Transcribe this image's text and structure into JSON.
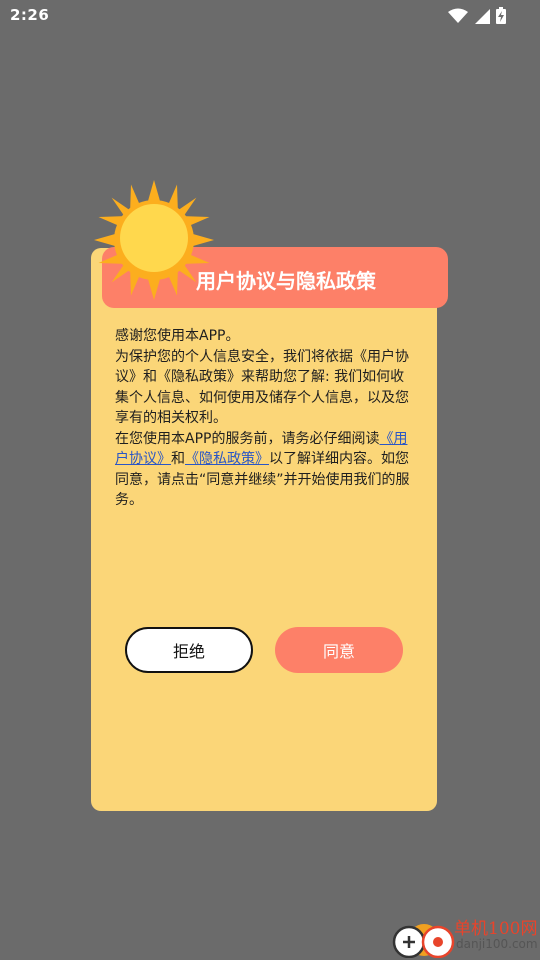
{
  "status_bar": {
    "time": "2:26",
    "icons": [
      "wifi-icon",
      "signal-icon",
      "battery-charging-icon"
    ]
  },
  "dialog": {
    "title": "用户协议与隐私政策",
    "paragraphs": {
      "p1": "感谢您使用本APP。",
      "p2": "为保护您的个人信息安全，我们将依据《用户协议》和《隐私政策》来帮助您了解: 我们如何收集个人信息、如何使用及储存个人信息，以及您享有的相关权利。",
      "p3_prefix": "在您使用本APP的服务前，请务必仔细阅读",
      "link_user_agreement": "《用户协议》",
      "and": "和",
      "link_privacy_policy": "《隐私政策》",
      "p3_suffix": "以了解详细内容。如您同意，请点击“同意并继续”并开始使用我们的服务。"
    },
    "buttons": {
      "reject": "拒绝",
      "agree": "同意"
    }
  },
  "colors": {
    "overlay": "#6b6b6b",
    "card": "#fbd678",
    "accent": "#fd8068",
    "link": "#2a56c6",
    "sun_core": "#ffd84d",
    "sun_rays": "#fcae1e"
  },
  "watermark": {
    "name": "单机100网",
    "url": "danji100.com"
  }
}
